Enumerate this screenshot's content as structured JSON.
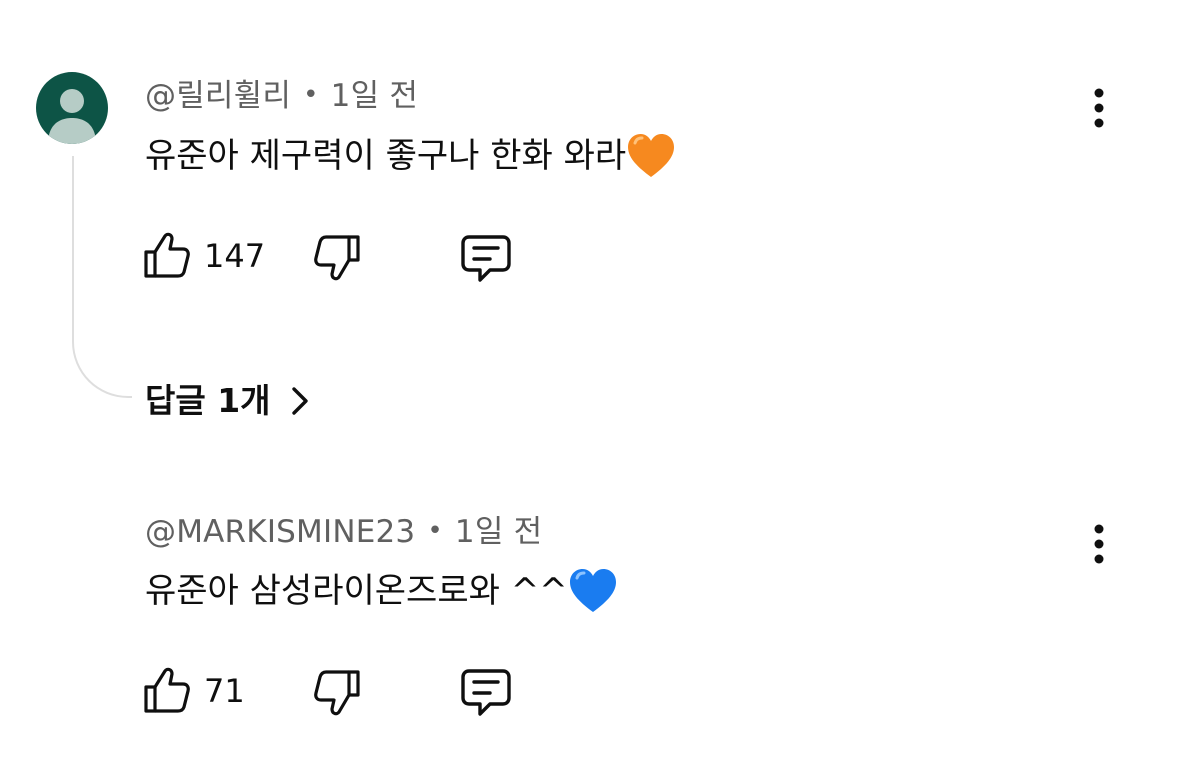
{
  "comments": [
    {
      "author": "@릴리휠리",
      "separator": "•",
      "time": "1일 전",
      "text": "유준아 제구력이 좋구나 한화 와라",
      "emoji": "orange-heart",
      "likes": "147",
      "has_avatar": true,
      "replies_label": "답글 1개"
    },
    {
      "author": "@MARKISMINE23",
      "separator": "•",
      "time": "1일 전",
      "text": "유준아 삼성라이온즈로와 ^^",
      "emoji": "blue-heart",
      "likes": "71",
      "has_avatar": false
    }
  ],
  "colors": {
    "avatar_bg": "#0d5446",
    "avatar_fg": "#b6ccc6",
    "meta_text": "#606060",
    "thread_line": "#dedede",
    "orange_heart": "#f6891f",
    "blue_heart": "#1a7cf0"
  },
  "icons": [
    "thumb-up-icon",
    "thumb-down-icon",
    "reply-comment-icon",
    "more-vert-icon",
    "chevron-right-icon",
    "person-icon"
  ]
}
